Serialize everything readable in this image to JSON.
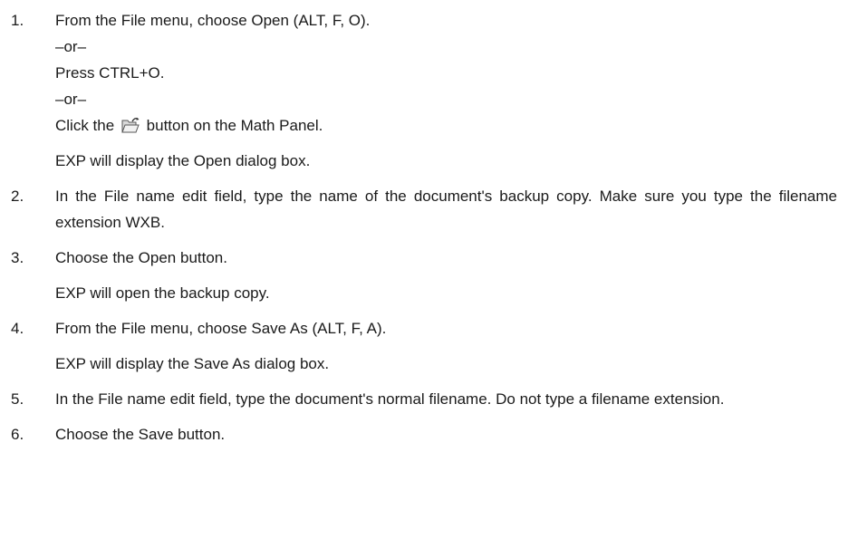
{
  "steps": [
    {
      "number": "1.",
      "lines": [
        "From the File menu, choose Open (ALT, F, O).",
        "–or–",
        "Press CTRL+O.",
        "–or–"
      ],
      "icon_line": {
        "before": "Click the",
        "icon": "open-folder-icon",
        "after": "button on the Math Panel."
      },
      "result": "EXP will display the Open dialog box."
    },
    {
      "number": "2.",
      "text": "In the File name edit field, type the name of the document's backup copy. Make sure you type the filename extension WXB."
    },
    {
      "number": "3.",
      "text": "Choose the Open button.",
      "result": "EXP will open the backup copy."
    },
    {
      "number": "4.",
      "text": "From the File menu, choose Save As (ALT, F, A).",
      "result": "EXP will display the Save As dialog box."
    },
    {
      "number": "5.",
      "text": "In the File name edit field, type the document's normal filename. Do not type a filename extension."
    },
    {
      "number": "6.",
      "text": "Choose the Save button."
    }
  ]
}
